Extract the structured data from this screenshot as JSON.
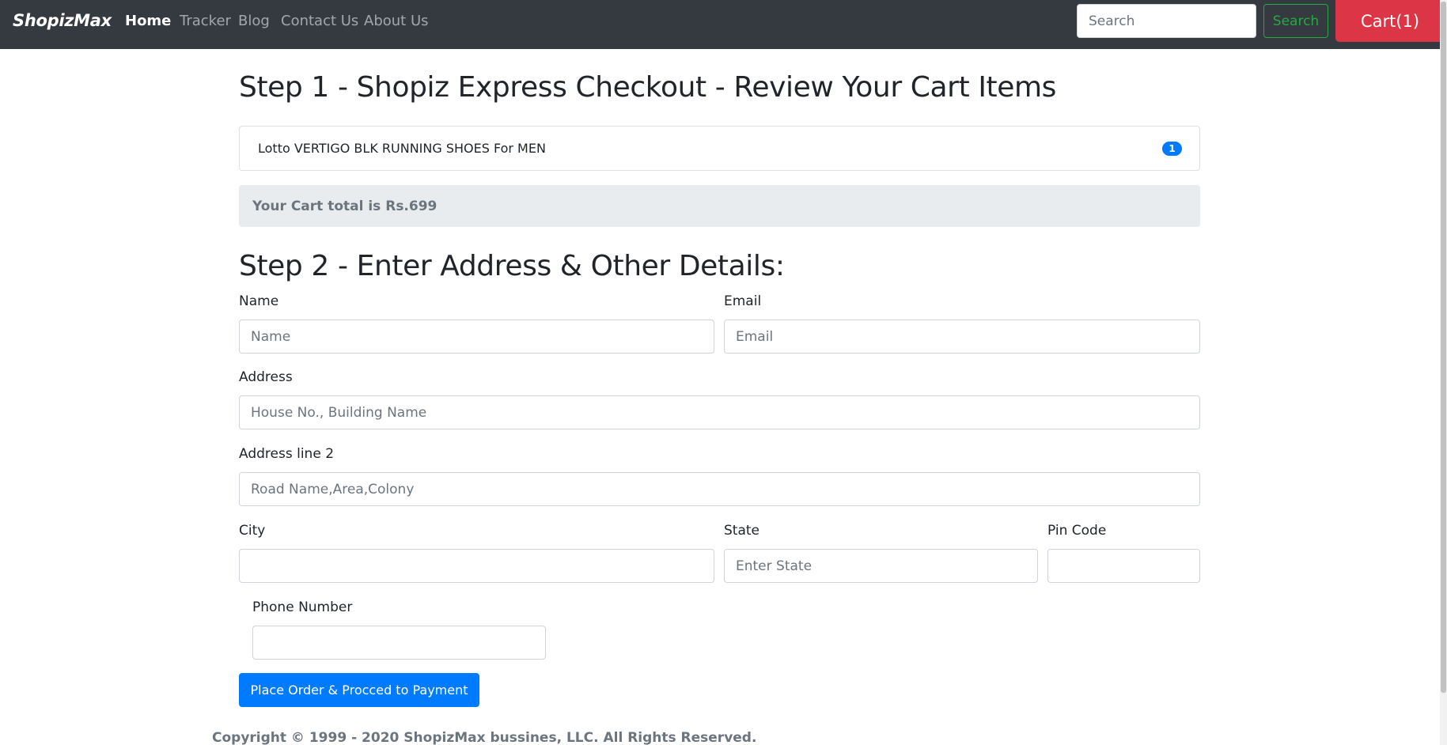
{
  "navbar": {
    "brand": "ShopizMax",
    "links": [
      {
        "label": "Home",
        "active": true
      },
      {
        "label": "Tracker",
        "active": false
      },
      {
        "label": "Blog",
        "active": false
      },
      {
        "label": "Contact Us",
        "active": false
      },
      {
        "label": "About Us",
        "active": false
      }
    ],
    "search_placeholder": "Search",
    "search_button": "Search",
    "cart_button": "Cart(1)"
  },
  "step1": {
    "heading": "Step 1 - Shopiz Express Checkout - Review Your Cart Items",
    "items": [
      {
        "name": "Lotto VERTIGO BLK RUNNING SHOES For MEN",
        "quantity": "1"
      }
    ],
    "cart_total": "Your Cart total is Rs.699"
  },
  "step2": {
    "heading": "Step 2 - Enter Address & Other Details:",
    "fields": {
      "name": {
        "label": "Name",
        "placeholder": "Name",
        "value": ""
      },
      "email": {
        "label": "Email",
        "placeholder": "Email",
        "value": ""
      },
      "address": {
        "label": "Address",
        "placeholder": "House No., Building Name",
        "value": ""
      },
      "address2": {
        "label": "Address line 2",
        "placeholder": "Road Name,Area,Colony",
        "value": ""
      },
      "city": {
        "label": "City",
        "placeholder": "",
        "value": ""
      },
      "state": {
        "label": "State",
        "placeholder": "Enter State",
        "value": ""
      },
      "pincode": {
        "label": "Pin Code",
        "placeholder": "",
        "value": ""
      },
      "phone": {
        "label": "Phone Number",
        "placeholder": "",
        "value": ""
      }
    },
    "submit_button": "Place Order & Procced to Payment"
  },
  "footer": {
    "copyright": "Copyright © 1999 - 2020 ShopizMax bussines, LLC. All Rights Reserved."
  },
  "colors": {
    "navbar_bg": "#343a40",
    "cart_button": "#dc3545",
    "search_button": "#28a745",
    "primary": "#007bff",
    "cart_total_bg": "#e9ecef"
  }
}
